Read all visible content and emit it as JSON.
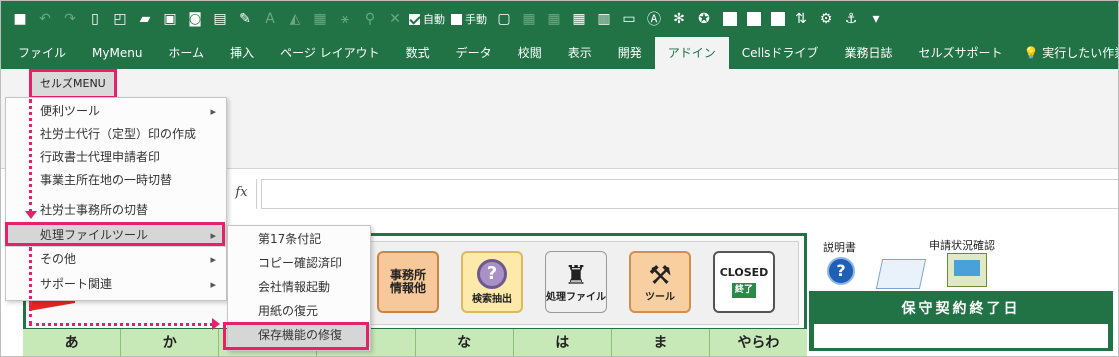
{
  "quick_access": {
    "icons": [
      "save-icon",
      "undo-icon",
      "redo-icon",
      "new-file-icon",
      "print-preview-icon",
      "open-folder-icon",
      "print-icon",
      "camera-icon",
      "format-painter-icon",
      "font-color-icon",
      "fill-color-icon",
      "borders-icon",
      "trace-icon",
      "network-icon",
      "grid-icon"
    ],
    "auto_label": "自動",
    "manual_label": "手動"
  },
  "ribbon": {
    "tabs": [
      "ファイル",
      "MyMenu",
      "ホーム",
      "挿入",
      "ページ レイアウト",
      "数式",
      "データ",
      "校閲",
      "表示",
      "開発",
      "アドイン",
      "Cellsドライブ",
      "業務日誌",
      "セルズサポート"
    ],
    "active_tab": "アドイン",
    "tell_me": "実行したい作業を"
  },
  "cells_menu": {
    "button_label": "セルズMENU ▾",
    "items": [
      {
        "label": "便利ツール",
        "has_submenu": true
      },
      {
        "label": "社労士代行（定型）印の作成",
        "has_submenu": false
      },
      {
        "label": "行政書士代理申請者印",
        "has_submenu": false
      },
      {
        "label": "事業主所在地の一時切替",
        "has_submenu": false
      },
      {
        "label": "社労士事務所の切替",
        "has_submenu": false
      },
      {
        "label": "処理ファイルツール",
        "has_submenu": true,
        "active": true
      },
      {
        "label": "その他",
        "has_submenu": true
      },
      {
        "label": "サポート関連",
        "has_submenu": true
      }
    ]
  },
  "submenu": {
    "items": [
      "第17条付記",
      "コピー確認済印",
      "会社情報起動",
      "用紙の復元",
      "保存機能の修復"
    ],
    "highlighted": "保存機能の修復"
  },
  "formula_bar": {
    "fx_label": "fx"
  },
  "tools": [
    {
      "label": "事務所\n情報他"
    },
    {
      "label": "検索抽出"
    },
    {
      "label": "処理ファイル"
    },
    {
      "label": "ツール"
    },
    {
      "label": "CLOSED",
      "sub": "終了"
    }
  ],
  "kana_tabs": [
    "あ",
    "か",
    "",
    "",
    "な",
    "は",
    "ま",
    "やらわ"
  ],
  "side": {
    "manual_label": "説明書",
    "status_label": "申請状況確認",
    "contract_end_title": "保守契約終了日"
  },
  "colors": {
    "excel_green": "#217346",
    "highlight_pink": "#e6206b",
    "kana_bg": "#c7e9b8"
  }
}
